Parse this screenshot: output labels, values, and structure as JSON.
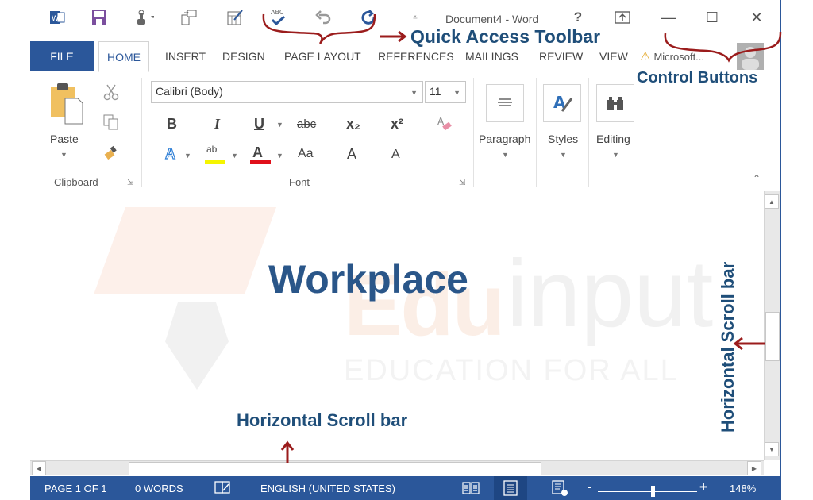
{
  "titlebar": {
    "document_title": "Document4 - Word",
    "qat_icons": [
      "word-logo",
      "save",
      "touch-mode",
      "new-document",
      "form-edit",
      "spelling-check",
      "undo",
      "redo"
    ],
    "help_label": "?",
    "ribbon_display_icon": "ribbon-display-options",
    "minimize_label": "—",
    "maximize_label": "☐",
    "close_label": "✕"
  },
  "tabs": {
    "items": [
      {
        "label": "FILE"
      },
      {
        "label": "HOME",
        "active": true
      },
      {
        "label": "INSERT"
      },
      {
        "label": "DESIGN"
      },
      {
        "label": "PAGE LAYOUT"
      },
      {
        "label": "REFERENCES"
      },
      {
        "label": "MAILINGS"
      },
      {
        "label": "REVIEW"
      },
      {
        "label": "VIEW"
      }
    ],
    "account_label": "Microsoft..."
  },
  "ribbon": {
    "clipboard": {
      "label": "Clipboard",
      "paste_label": "Paste"
    },
    "font": {
      "label": "Font",
      "font_name": "Calibri (Body)",
      "font_size": "11",
      "bold": "B",
      "italic": "I",
      "underline": "U",
      "strikethrough": "abc",
      "subscript": "x₂",
      "superscript": "x²",
      "text_effects": "A",
      "highlight": "ab",
      "font_color": "A",
      "change_case": "Aa",
      "grow_font": "A",
      "shrink_font": "A",
      "highlight_color": "#f5f500",
      "font_color_bar": "#e0101a"
    },
    "paragraph": {
      "label": "Paragraph"
    },
    "styles": {
      "label": "Styles"
    },
    "editing": {
      "label": "Editing"
    }
  },
  "document": {
    "heading": "Workplace",
    "watermark_edu": "Edu",
    "watermark_input": "input",
    "watermark_sub": "EDUCATION FOR ALL"
  },
  "annotations": {
    "quick_access": "Quick Access Toolbar",
    "control_buttons": "Control Buttons",
    "horizontal_scroll": "Horizontal Scroll bar",
    "vertical_scroll": "Horizontal Scroll bar"
  },
  "statusbar": {
    "page": "PAGE 1 OF 1",
    "words": "0 WORDS",
    "language": "ENGLISH (UNITED STATES)",
    "zoom_minus": "-",
    "zoom_plus": "+",
    "zoom_level": "148%",
    "zoom_fraction": 0.55
  },
  "colors": {
    "brand": "#2b579a",
    "annotation_text": "#1f4e79",
    "annotation_arrow": "#9b1c1c"
  }
}
